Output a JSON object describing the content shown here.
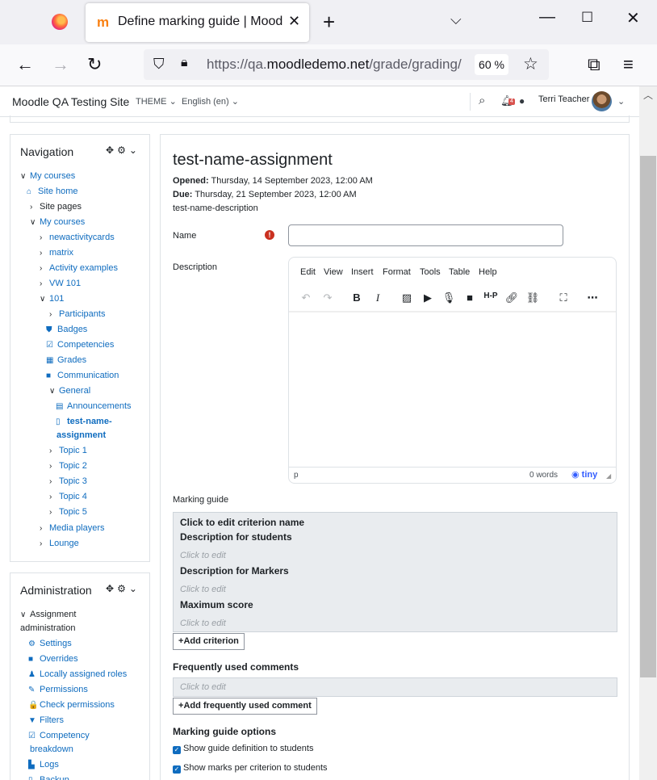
{
  "browser": {
    "tab_title": "Define marking guide | Moodle QA",
    "new_tab": "+",
    "url_prefix": "https://qa.",
    "url_domain": "moodledemo.net",
    "url_path": "/grade/grading/",
    "zoom": "60 %"
  },
  "header": {
    "site_name": "Moodle QA Testing Site",
    "theme": "THEME",
    "language": "English (en)",
    "notification_count": "4",
    "user_name": "Terri Teacher"
  },
  "navigation": {
    "title": "Navigation",
    "items": [
      {
        "label": "My courses",
        "chev": "∨",
        "icon": ""
      },
      {
        "label": "Site home",
        "chev": "",
        "icon": "⌂"
      },
      {
        "label": "Site pages",
        "chev": "›",
        "icon": ""
      },
      {
        "label": "My courses",
        "chev": "∨",
        "icon": ""
      },
      {
        "label": "newactivitycards",
        "chev": "›",
        "icon": ""
      },
      {
        "label": "matrix",
        "chev": "›",
        "icon": ""
      },
      {
        "label": "Activity examples",
        "chev": "›",
        "icon": ""
      },
      {
        "label": "VW 101",
        "chev": "›",
        "icon": ""
      },
      {
        "label": "101",
        "chev": "∨",
        "icon": ""
      },
      {
        "label": "Participants",
        "chev": "›",
        "icon": ""
      },
      {
        "label": "Badges",
        "chev": "",
        "icon": "⛊"
      },
      {
        "label": "Competencies",
        "chev": "",
        "icon": "☑"
      },
      {
        "label": "Grades",
        "chev": "",
        "icon": "▦"
      },
      {
        "label": "Communication",
        "chev": "",
        "icon": "■"
      },
      {
        "label": "General",
        "chev": "∨",
        "icon": ""
      },
      {
        "label": "Announcements",
        "chev": "",
        "icon": "▤"
      },
      {
        "label": "test-name-",
        "chev": "",
        "icon": "▯"
      },
      {
        "label": "assignment",
        "chev": "",
        "icon": ""
      },
      {
        "label": "Topic 1",
        "chev": "›",
        "icon": ""
      },
      {
        "label": "Topic 2",
        "chev": "›",
        "icon": ""
      },
      {
        "label": "Topic 3",
        "chev": "›",
        "icon": ""
      },
      {
        "label": "Topic 4",
        "chev": "›",
        "icon": ""
      },
      {
        "label": "Topic 5",
        "chev": "›",
        "icon": ""
      },
      {
        "label": "Media players",
        "chev": "›",
        "icon": ""
      },
      {
        "label": "Lounge",
        "chev": "›",
        "icon": ""
      }
    ]
  },
  "administration": {
    "title": "Administration",
    "items": [
      {
        "label": "Assignment",
        "chev": "∨",
        "icon": ""
      },
      {
        "label": "administration",
        "chev": "",
        "icon": ""
      },
      {
        "label": "Settings",
        "chev": "",
        "icon": "⚙"
      },
      {
        "label": "Overrides",
        "chev": "",
        "icon": "■"
      },
      {
        "label": "Locally assigned roles",
        "chev": "",
        "icon": "♟"
      },
      {
        "label": "Permissions",
        "chev": "",
        "icon": "✎"
      },
      {
        "label": "Check permissions",
        "chev": "",
        "icon": "🔒"
      },
      {
        "label": "Filters",
        "chev": "",
        "icon": "▼"
      },
      {
        "label": "Competency",
        "chev": "",
        "icon": "☑"
      },
      {
        "label": "breakdown",
        "chev": "",
        "icon": ""
      },
      {
        "label": "Logs",
        "chev": "",
        "icon": "▙"
      },
      {
        "label": "Backup",
        "chev": "",
        "icon": "▯"
      }
    ]
  },
  "main": {
    "title": "test-name-assignment",
    "opened_label": "Opened:",
    "opened_value": "Thursday, 14 September 2023, 12:00 AM",
    "due_label": "Due:",
    "due_value": "Thursday, 21 September 2023, 12:00 AM",
    "description": "test-name-description",
    "name_label": "Name",
    "name_value": "",
    "description_label": "Description",
    "editor": {
      "menus": [
        "Edit",
        "View",
        "Insert",
        "Format",
        "Tools",
        "Table",
        "Help"
      ],
      "path": "p",
      "word_count": "0 words",
      "brand": "tiny"
    },
    "marking_guide_label": "Marking guide",
    "criterion_name": "Click to edit criterion name",
    "desc_students": "Description for students",
    "desc_markers": "Description for Markers",
    "max_score": "Maximum score",
    "click_to_edit": "Click to edit",
    "add_criterion": "Add criterion",
    "fuc_title": "Frequently used comments",
    "add_fuc": "Add frequently used comment",
    "options_title": "Marking guide options",
    "option_1": "Show guide definition to students",
    "option_2": "Show marks per criterion to students"
  }
}
